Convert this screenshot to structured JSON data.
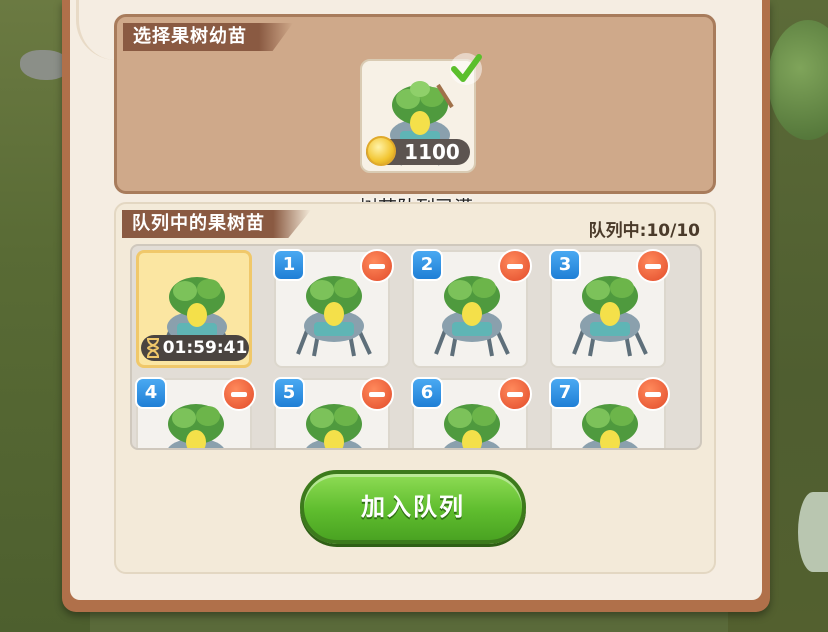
{
  "select_section": {
    "title": "选择果树幼苗",
    "selected_item": {
      "price": "1100",
      "price_icon": "coin-icon",
      "selected_icon": "check-icon"
    }
  },
  "notice": "树苗队列已满",
  "queue_section": {
    "title": "队列中的果树苗",
    "count_label": "队列中:10/10",
    "active_slot": {
      "timer": "01:59:41",
      "timer_icon": "hourglass-icon"
    },
    "slots": [
      {
        "number": "1"
      },
      {
        "number": "2"
      },
      {
        "number": "3"
      },
      {
        "number": "4"
      },
      {
        "number": "5"
      },
      {
        "number": "6"
      },
      {
        "number": "7"
      }
    ]
  },
  "add_button_label": "加入队列",
  "colors": {
    "accent_green": "#5fbd2e",
    "badge_blue": "#1f7fd6",
    "remove_red": "#e24b2a",
    "title_brown": "#8a5a42"
  }
}
